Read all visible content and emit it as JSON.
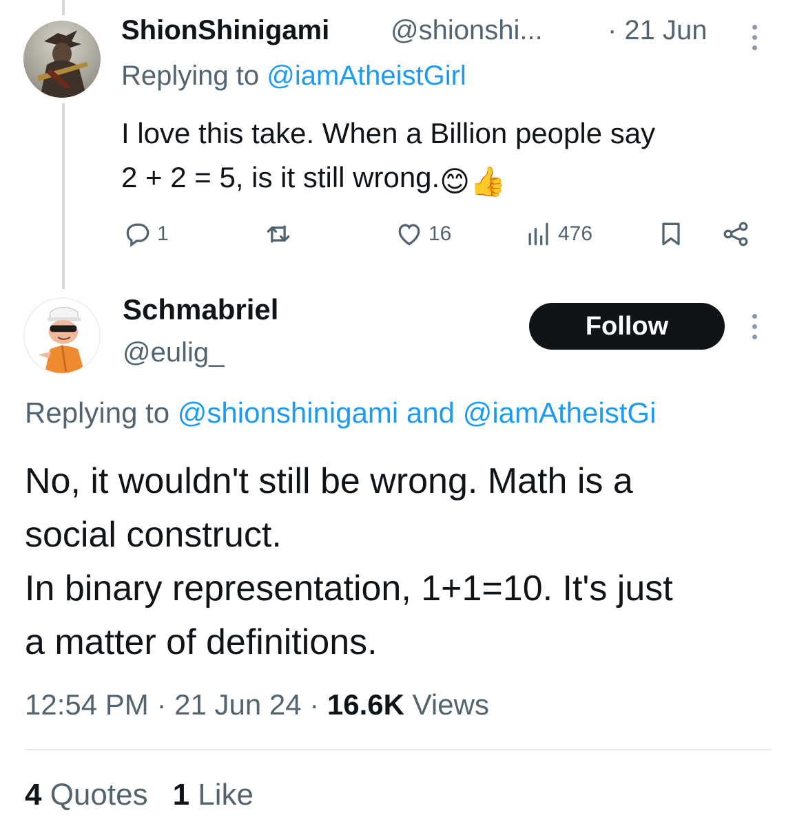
{
  "tweet1": {
    "display_name": "ShionShinigami",
    "handle": "@shionshi...",
    "date": "· 21 Jun",
    "replying_prefix": "Replying to ",
    "replying_to": "@iamAtheistGirl",
    "text_line1": "I love this take. When a Billion people say",
    "text_line2": "2 + 2 = 5, is it still wrong.",
    "emojis": "😊👍",
    "actions": {
      "reply_count": "1",
      "retweet_count": "",
      "like_count": "16",
      "views_count": "476"
    }
  },
  "tweet2": {
    "display_name": "Schmabriel",
    "handle": "@eulig_",
    "follow_label": "Follow",
    "replying_prefix": "Replying to ",
    "replying_mention1": "@shionshinigami",
    "replying_and": " and ",
    "replying_mention2": "@iamAtheistGi",
    "text_line1": "No, it wouldn't still be wrong. Math is a",
    "text_line2": "social construct.",
    "text_line3": "In binary representation, 1+1=10. It's just",
    "text_line4": "a matter of definitions.",
    "time": "12:54 PM · 21 Jun 24 · ",
    "views_count": "16.6K",
    "views_label": " Views",
    "quotes_count": "4",
    "quotes_label": " Quotes",
    "likes_count": "1",
    "likes_label": " Like"
  },
  "colors": {
    "text_primary": "#0f1419",
    "text_secondary": "#536471",
    "link_blue": "#1d9bf0",
    "follow_bg": "#0f1419"
  },
  "icons": [
    "reply-icon",
    "retweet-icon",
    "heart-icon",
    "views-icon",
    "bookmark-icon",
    "share-icon",
    "more-icon"
  ]
}
